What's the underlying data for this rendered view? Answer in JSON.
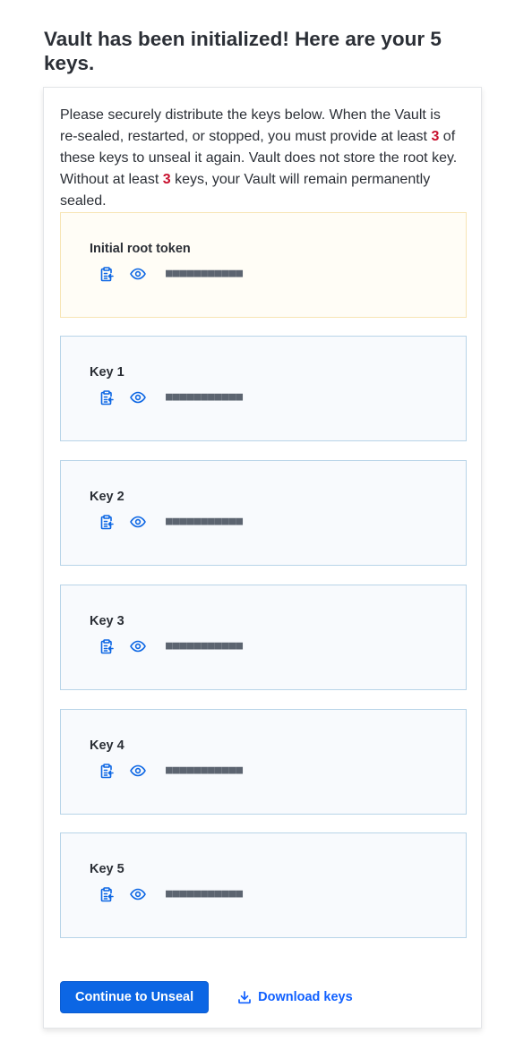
{
  "page": {
    "title": "Vault has been initialized! Here are your 5 keys."
  },
  "intro": {
    "part1": "Please securely distribute the keys below. When the Vault is re-sealed, restarted, or stopped, you must provide at least ",
    "threshold": "3",
    "part2": " of these keys to unseal it again. Vault does not store the root key. Without at least ",
    "part3": " keys, your Vault will remain permanently sealed."
  },
  "keys": [
    {
      "label": "Initial root token",
      "masked": "■■■■■■■■■■■"
    },
    {
      "label": "Key 1",
      "masked": "■■■■■■■■■■■"
    },
    {
      "label": "Key 2",
      "masked": "■■■■■■■■■■■"
    },
    {
      "label": "Key 3",
      "masked": "■■■■■■■■■■■"
    },
    {
      "label": "Key 4",
      "masked": "■■■■■■■■■■■"
    },
    {
      "label": "Key 5",
      "masked": "■■■■■■■■■■■"
    }
  ],
  "actions": {
    "continue_label": "Continue to Unseal",
    "download_label": "Download keys"
  },
  "icons": {
    "copy": "clipboard-copy-icon",
    "reveal": "eye-icon",
    "download": "download-icon"
  },
  "colors": {
    "primary": "#0c66e4",
    "link": "#1060ff",
    "threshold": "#c8102e",
    "root_box_border": "#f7e5b5",
    "root_box_bg": "#fffdf6",
    "key_box_border": "#b8d4e8",
    "key_box_bg": "#f8fafd"
  }
}
